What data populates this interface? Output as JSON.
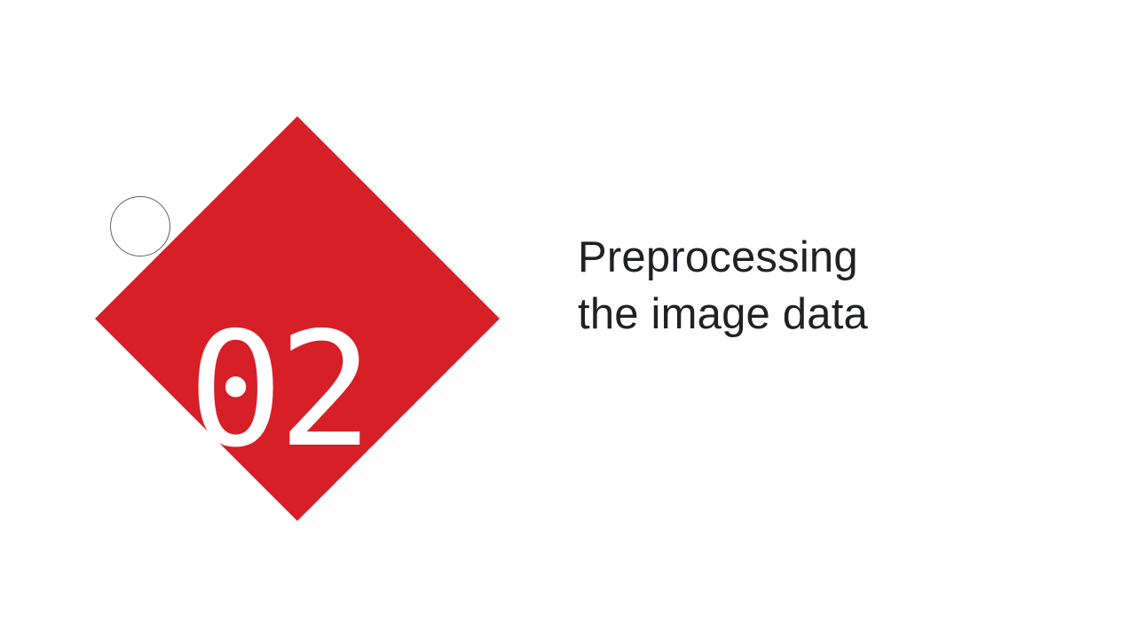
{
  "slide": {
    "section_number": "02",
    "title_line_1": "Preprocessing",
    "title_line_2": "the image data"
  },
  "colors": {
    "accent": "#d71f27",
    "background": "#ffffff",
    "title_text": "#202124",
    "number_text": "#ffffff"
  }
}
